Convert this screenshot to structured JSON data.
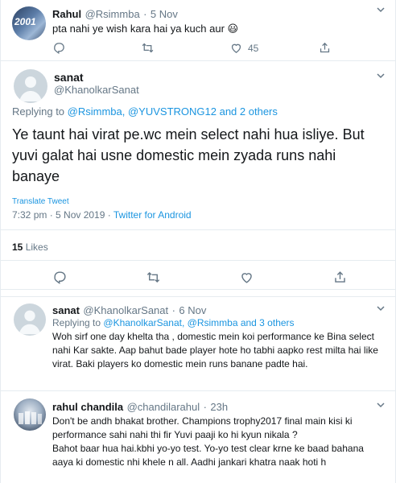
{
  "tweet1": {
    "name": "Rahul",
    "handle": "@Rsimmba",
    "dot": "·",
    "date": "5 Nov",
    "text": "pta nahi ye wish kara hai ya kuch aur 😃",
    "retweets": "",
    "likes": "45",
    "avatar_text": "2001"
  },
  "main": {
    "name": "sanat",
    "handle": "@KhanolkarSanat",
    "replying_prefix": "Replying to",
    "replying_links": "@Rsimmba, @YUVSTRONG12 and 2 others",
    "text": "Ye taunt hai virat pe.wc mein select nahi hua isliye. But yuvi galat hai usne domestic mein zyada runs nahi banaye",
    "translate": "Translate Tweet",
    "time": "7:32 pm · 5 Nov 2019",
    "dot": "·",
    "client": "Twitter for Android",
    "likes_count": "15",
    "likes_label": "Likes"
  },
  "reply1": {
    "name": "sanat",
    "handle": "@KhanolkarSanat",
    "dot": "·",
    "date": "6 Nov",
    "replying_prefix": "Replying to",
    "replying_links": "@KhanolkarSanat, @Rsimmba and 3 others",
    "text": "Woh sirf one day khelta tha , domestic mein koi performance ke Bina select nahi Kar sakte. Aap bahut bade player hote ho tabhi aapko rest milta hai like virat. Baki players ko domestic mein runs banane padte hai."
  },
  "reply2": {
    "name": "rahul chandila",
    "handle": "@chandilarahul",
    "dot": "·",
    "date": "23h",
    "text1": "Don't be andh bhakat brother. Champions trophy2017 final main kisi ki performance sahi nahi thi fir Yuvi paaji ko hi kyun nikala ?",
    "text2": "Bahot baar hua hai.kbhi yo-yo test. Yo-yo test clear krne ke baad bahana aaya ki domestic nhi khele n all. Aadhi jankari khatra naak hoti h"
  },
  "colors": {
    "link": "#1b95e0",
    "muted": "#657786",
    "border": "#e6ecf0"
  },
  "icons": [
    "reply-icon",
    "retweet-icon",
    "like-icon",
    "share-icon",
    "chevron-down-icon",
    "default-avatar-icon"
  ]
}
